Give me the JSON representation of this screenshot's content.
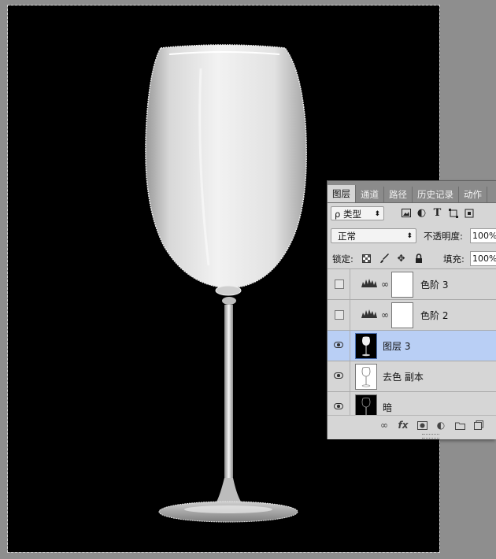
{
  "document": {
    "selection": "marching-ants"
  },
  "layers_panel": {
    "tabs": [
      {
        "label": "图层",
        "active": true
      },
      {
        "label": "通道",
        "active": false
      },
      {
        "label": "路径",
        "active": false
      },
      {
        "label": "历史记录",
        "active": false
      },
      {
        "label": "动作",
        "active": false
      }
    ],
    "filter": {
      "label": "ρ 类型",
      "arrow": "⌃⌄"
    },
    "filter_icons": [
      "image-icon",
      "adjustment-icon",
      "type-icon",
      "shape-icon",
      "smart-object-icon"
    ],
    "blend_mode": "正常",
    "opacity_label": "不透明度:",
    "opacity_value": "100%",
    "lock_label": "锁定:",
    "fill_label": "填充:",
    "fill_value": "100%",
    "layers": [
      {
        "name": "色阶 3",
        "visible": false,
        "type": "levels-adjustment",
        "selected": false
      },
      {
        "name": "色阶 2",
        "visible": false,
        "type": "levels-adjustment",
        "selected": false
      },
      {
        "name": "图层 3",
        "visible": true,
        "type": "pixel",
        "selected": true
      },
      {
        "name": "去色 副本",
        "visible": true,
        "type": "pixel",
        "selected": false
      },
      {
        "name": "暗",
        "visible": true,
        "type": "pixel",
        "selected": false
      }
    ],
    "bottom_icons": [
      "link-icon",
      "fx-icon",
      "mask-icon",
      "adjustment-icon",
      "folder-icon",
      "new-layer-icon"
    ],
    "fx_label": "fx"
  },
  "colors": {
    "selection_highlight": "#b9cff5",
    "panel_bg": "#d6d6d6",
    "workspace": "#8e8e8e"
  }
}
